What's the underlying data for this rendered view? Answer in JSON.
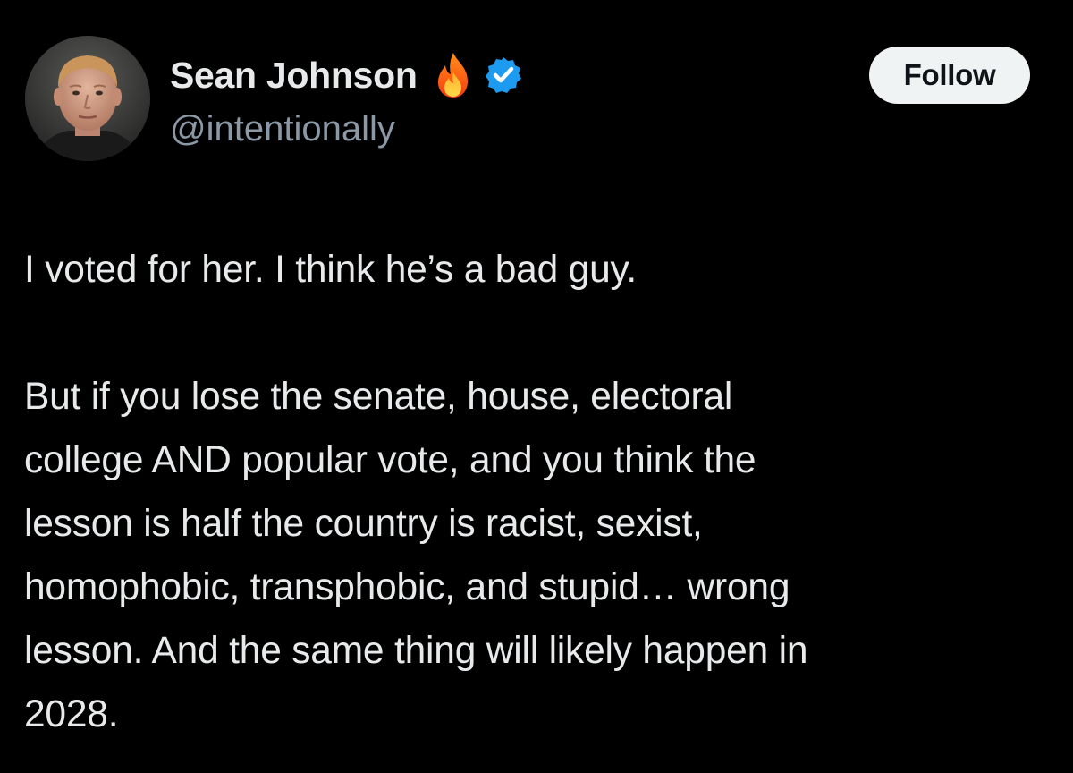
{
  "author": {
    "display_name": "Sean Johnson",
    "handle": "@intentionally",
    "name_emoji": "fire-icon",
    "verified_badge": "verified-icon",
    "avatar": "avatar"
  },
  "follow_label": "Follow",
  "colors": {
    "background": "#000000",
    "text_primary": "#e7e9ea",
    "text_secondary": "#8b98a5",
    "verified_blue": "#1d9bf0",
    "button_bg": "#eff3f4",
    "button_text": "#0f1419"
  },
  "tweet": {
    "paragraphs": [
      {
        "lines": [
          "I voted for her. I think he’s a bad guy."
        ]
      },
      {
        "lines": [
          "But if you lose the senate, house, electoral",
          "college AND popular vote, and you think the",
          "lesson is half the country is racist, sexist,",
          "homophobic, transphobic, and stupid… wrong",
          "lesson. And the same thing will likely happen in",
          "2028."
        ]
      }
    ]
  }
}
